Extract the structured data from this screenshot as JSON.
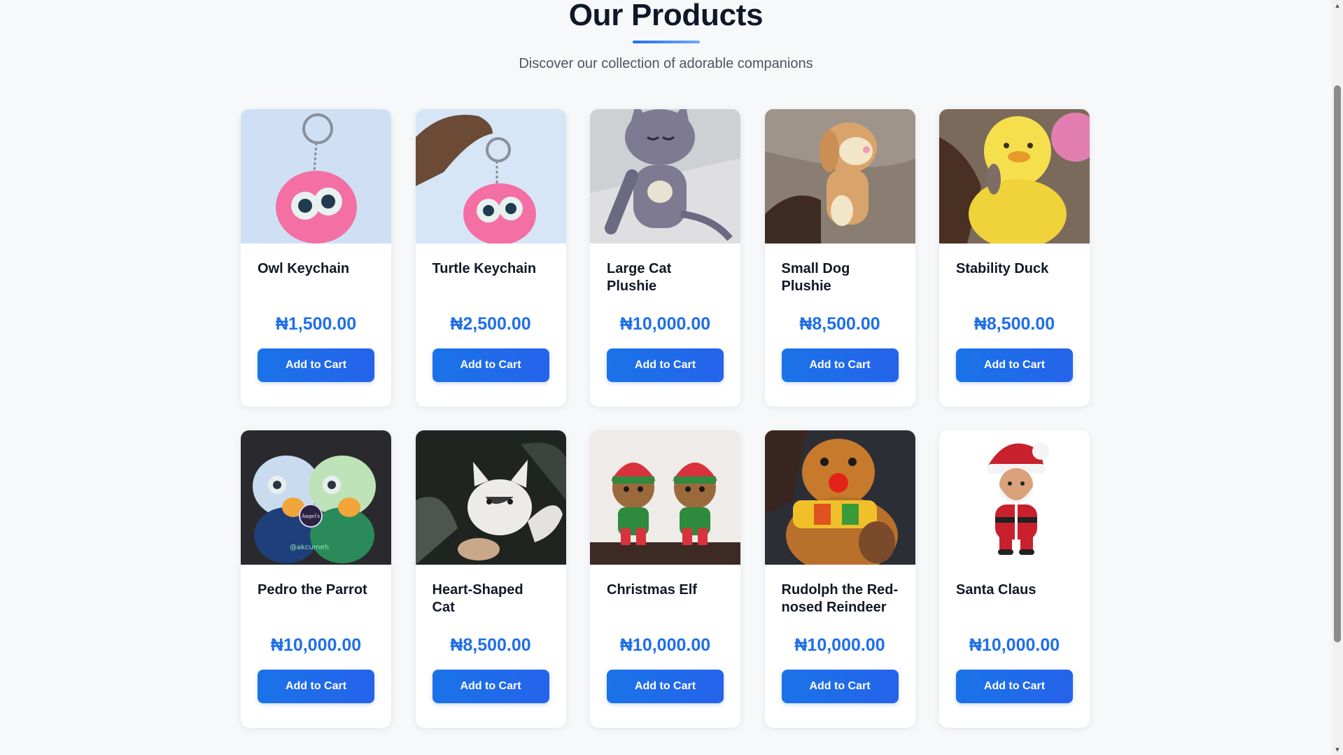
{
  "section": {
    "title": "Our Products",
    "subtitle": "Discover our collection of adorable companions"
  },
  "products": [
    {
      "name": "Owl Keychain",
      "price": "₦1,500.00",
      "button": "Add to Cart",
      "image_icon": "owl-keychain-image"
    },
    {
      "name": "Turtle Keychain",
      "price": "₦2,500.00",
      "button": "Add to Cart",
      "image_icon": "turtle-keychain-image"
    },
    {
      "name": "Large Cat Plushie",
      "price": "₦10,000.00",
      "button": "Add to Cart",
      "image_icon": "cat-plushie-image"
    },
    {
      "name": "Small Dog Plushie",
      "price": "₦8,500.00",
      "button": "Add to Cart",
      "image_icon": "dog-plushie-image"
    },
    {
      "name": "Stability Duck",
      "price": "₦8,500.00",
      "button": "Add to Cart",
      "image_icon": "duck-image"
    },
    {
      "name": "Pedro the Parrot",
      "price": "₦10,000.00",
      "button": "Add to Cart",
      "image_icon": "parrot-image"
    },
    {
      "name": "Heart-Shaped Cat",
      "price": "₦8,500.00",
      "button": "Add to Cart",
      "image_icon": "heart-cat-image"
    },
    {
      "name": "Christmas Elf",
      "price": "₦10,000.00",
      "button": "Add to Cart",
      "image_icon": "elf-image"
    },
    {
      "name": "Rudolph the Red-nosed Reindeer",
      "price": "₦10,000.00",
      "button": "Add to Cart",
      "image_icon": "reindeer-image"
    },
    {
      "name": "Santa Claus",
      "price": "₦10,000.00",
      "button": "Add to Cart",
      "image_icon": "santa-image"
    }
  ],
  "colors": {
    "accent": "#1f6fe8",
    "background": "#f7f8fa",
    "card": "#ffffff",
    "title": "#101828"
  },
  "photo_text": {
    "parrot_badge": "Angel's",
    "parrot_handle": "@akcumeh"
  }
}
